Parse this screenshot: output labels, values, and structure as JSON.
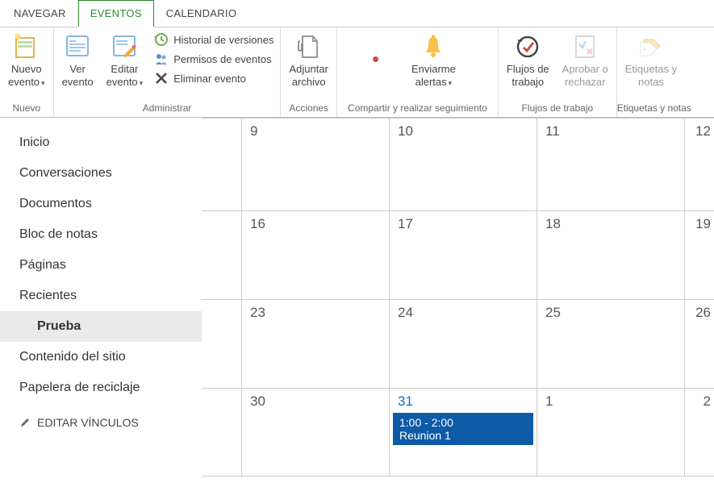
{
  "tabs": {
    "navegar": "NAVEGAR",
    "eventos": "EVENTOS",
    "calendario": "CALENDARIO"
  },
  "ribbon": {
    "nuevo": {
      "label": "Nuevo",
      "nuevo_evento": "Nuevo\nevento"
    },
    "administrar": {
      "label": "Administrar",
      "ver_evento": "Ver\nevento",
      "editar_evento": "Editar\nevento",
      "historial": "Historial de versiones",
      "permisos": "Permisos de eventos",
      "eliminar": "Eliminar evento"
    },
    "acciones": {
      "label": "Acciones",
      "adjuntar": "Adjuntar\narchivo"
    },
    "compartir": {
      "label": "Compartir y realizar seguimiento",
      "alertas": "Enviarme\nalertas"
    },
    "flujos": {
      "label": "Flujos de trabajo",
      "flujos_btn": "Flujos de\ntrabajo",
      "aprobar": "Aprobar o\nrechazar"
    },
    "etiquetas": {
      "label": "Etiquetas y notas",
      "etiquetas_btn": "Etiquetas y\nnotas"
    }
  },
  "sidebar": {
    "items": [
      "Inicio",
      "Conversaciones",
      "Documentos",
      "Bloc de notas",
      "Páginas",
      "Recientes"
    ],
    "sub": "Prueba",
    "rest": [
      "Contenido del sitio",
      "Papelera de reciclaje"
    ],
    "edit": "EDITAR VÍNCULOS"
  },
  "calendar": {
    "rows": [
      [
        "9",
        "10",
        "11",
        "12"
      ],
      [
        "16",
        "17",
        "18",
        "19"
      ],
      [
        "23",
        "24",
        "25",
        "26"
      ],
      [
        "30",
        "31",
        "1",
        "2"
      ]
    ],
    "selected_day": "31",
    "event": {
      "time": "1:00 - 2:00",
      "title": "Reunion 1"
    }
  }
}
